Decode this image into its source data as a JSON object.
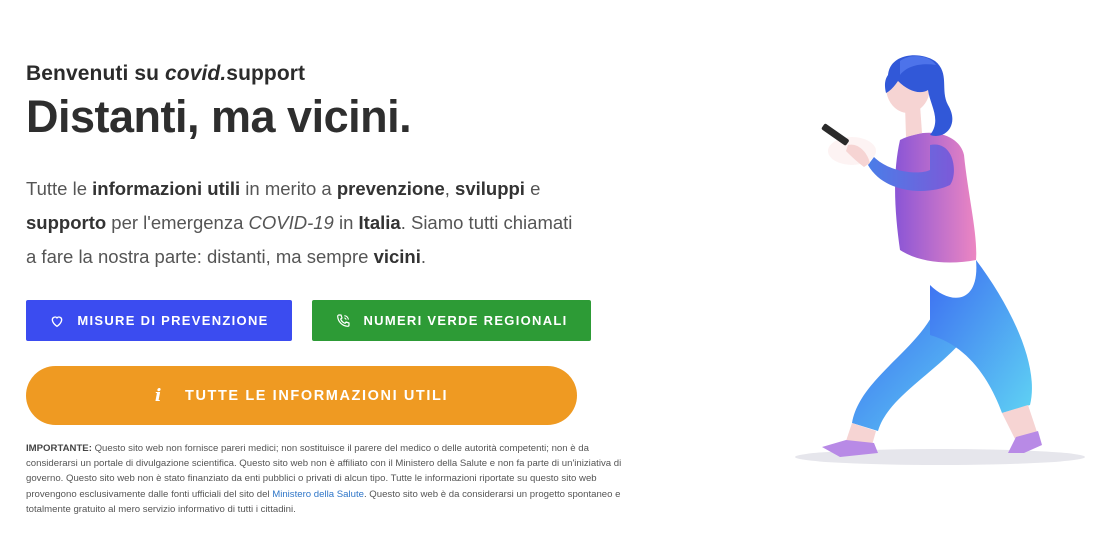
{
  "header": {
    "welcome_prefix": "Benvenuti su ",
    "welcome_brand_italic": "covid.",
    "welcome_brand_rest": "support",
    "headline": "Distanti, ma vicini."
  },
  "intro": {
    "p1": "Tutte le ",
    "b1": "informazioni utili",
    "p2": " in merito a ",
    "b2": "prevenzione",
    "p3": ", ",
    "b3": "sviluppi",
    "p4": " e ",
    "b4": "supporto",
    "p5": " per l'emergenza ",
    "i1": "COVID-19",
    "p6": " in ",
    "b5": "Italia",
    "p7": ". Siamo tutti chiamati a fare la nostra parte: distanti, ma sempre ",
    "b6": "vicini",
    "p8": "."
  },
  "buttons": {
    "prevention": {
      "label": "MISURE DI PREVENZIONE",
      "icon": "heart-icon",
      "color": "#3b4cf0"
    },
    "numbers": {
      "label": "NUMERI VERDE REGIONALI",
      "icon": "phone-icon",
      "color": "#2d9b36"
    },
    "info": {
      "label": "TUTTE LE INFORMAZIONI UTILI",
      "icon": "info-icon",
      "icon_glyph": "i",
      "color": "#ef9a22"
    }
  },
  "disclaimer": {
    "label": "IMPORTANTE:",
    "text1": " Questo sito web non fornisce pareri medici; non sostituisce il parere del medico o delle autorità competenti; non è da considerarsi un portale di divulgazione scientifica. Questo sito web non è affiliato con il Ministero della Salute e non fa parte di un'iniziativa di governo. Questo sito web non è stato finanziato da enti pubblici o privati di alcun tipo.  Tutte le informazioni riportate su questo sito web provengono esclusivamente dalle fonti ufficiali del sito del ",
    "link": "Ministero della Salute",
    "text2": ". Questo sito web è da considerarsi un progetto spontaneo e totalmente gratuito al mero servizio informativo di tutti i cittadini."
  },
  "illustration": {
    "name": "woman-walking-with-phone-illustration"
  }
}
